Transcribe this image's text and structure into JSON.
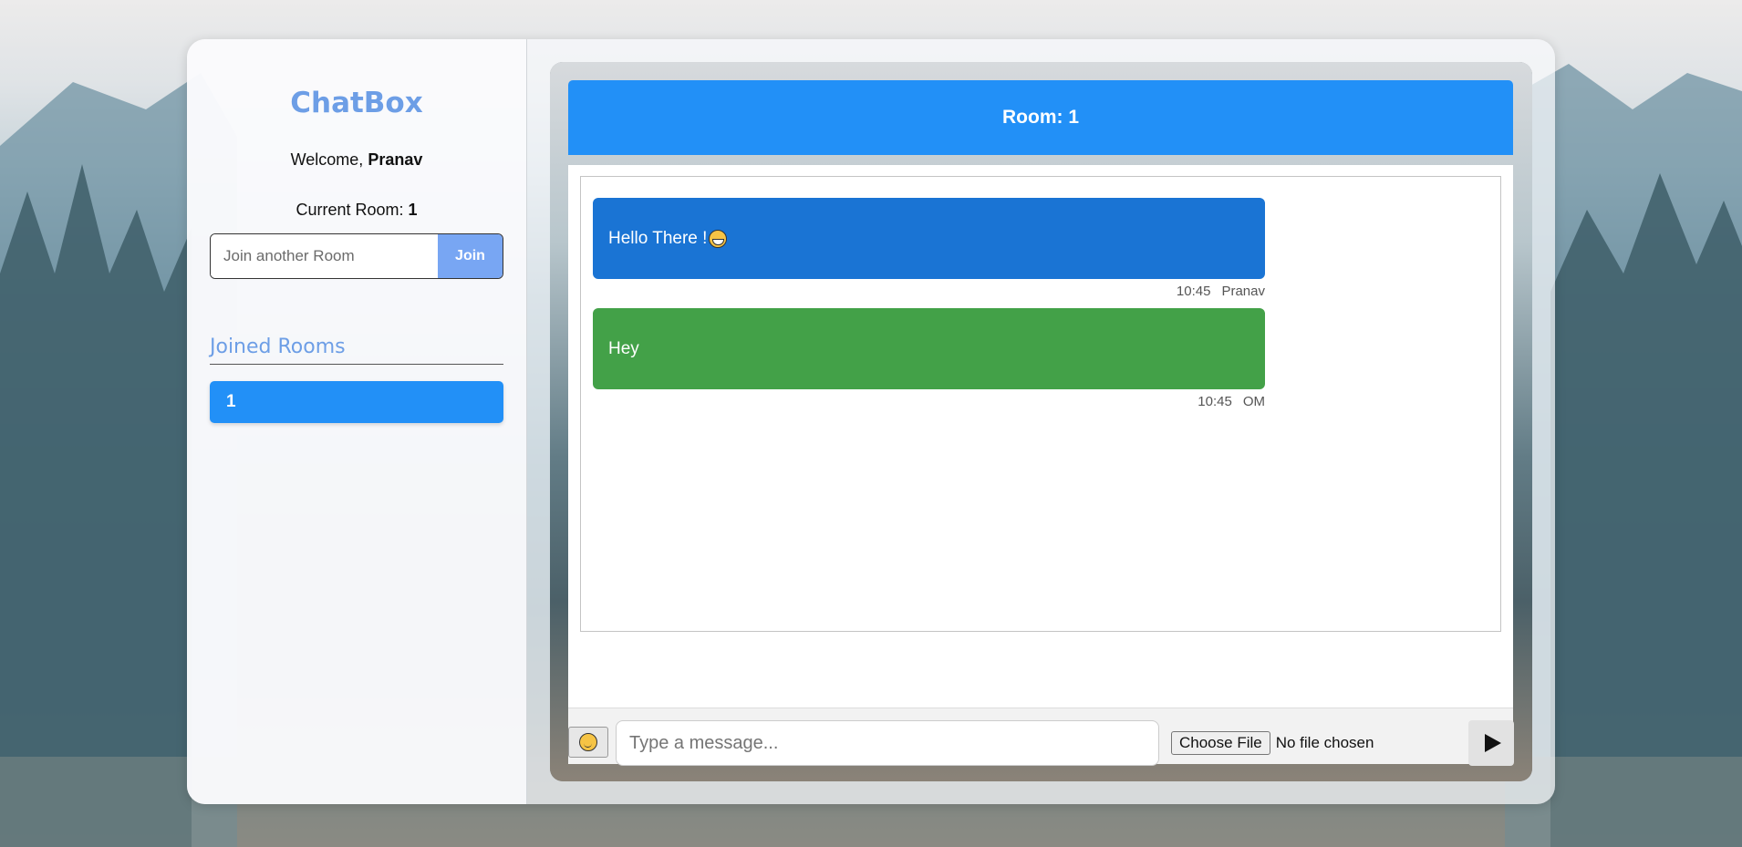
{
  "sidebar": {
    "brand": "ChatBox",
    "welcome_prefix": "Welcome,",
    "username": "Pranav",
    "current_room_prefix": "Current Room:",
    "current_room": "1",
    "join_placeholder": "Join another Room",
    "join_button": "Join",
    "joined_rooms_title": "Joined Rooms",
    "rooms": [
      {
        "label": "1"
      }
    ]
  },
  "chat": {
    "header": "Room: 1",
    "messages": [
      {
        "text": "Hello There !",
        "emoji": "grinning-face",
        "time": "10:45",
        "sender": "Pranav",
        "color": "#1a74d4"
      },
      {
        "text": "Hey",
        "time": "10:45",
        "sender": "OM",
        "color": "#43a148"
      }
    ],
    "composer": {
      "placeholder": "Type a message...",
      "choose_file": "Choose File",
      "file_status": "No file chosen",
      "emoji_icon": "smiley-icon",
      "send_icon": "send-icon"
    }
  },
  "colors": {
    "accent": "#2290f7",
    "brand": "#6d9ee6",
    "join_button": "#78a6f3"
  }
}
